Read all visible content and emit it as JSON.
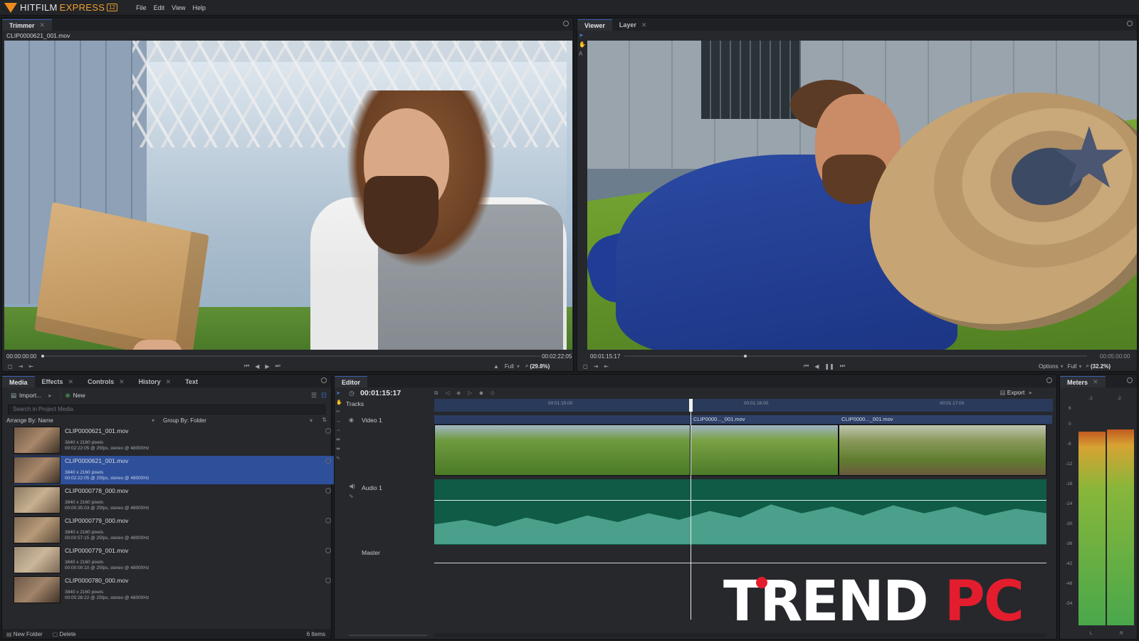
{
  "app": {
    "brand_main": "HITFILM",
    "brand_sub": "EXPRESS",
    "version": "12",
    "menu": [
      "File",
      "Edit",
      "View",
      "Help"
    ]
  },
  "trimmer": {
    "tab": "Trimmer",
    "clip_name": "CLIP0000621_001.mov",
    "time_start": "00:00:00:00",
    "time_end": "00:02:22:05",
    "quality": "Full",
    "zoom": "(29.8%)"
  },
  "viewer": {
    "tabs": [
      "Viewer",
      "Layer"
    ],
    "time_current": "00:01:15:17",
    "time_end": "00:05:00:00",
    "options": "Options",
    "quality": "Full",
    "zoom": "(32.2%)"
  },
  "media_panel": {
    "tabs": [
      "Media",
      "Effects",
      "Controls",
      "History",
      "Text"
    ],
    "import_label": "Import...",
    "new_label": "New",
    "search_placeholder": "Search in Project Media",
    "arrange_by": "Arrange By: Name",
    "group_by": "Group By: Folder",
    "items": [
      {
        "name": "CLIP0000621_001.mov",
        "size": "3840 x 2160 pixels",
        "details": "00:02:22:05 @ 25fps, stereo @ 48000Hz"
      },
      {
        "name": "CLIP0000621_001.mov",
        "size": "3840 x 2160 pixels",
        "details": "00:02:22:05 @ 25fps, stereo @ 48000Hz"
      },
      {
        "name": "CLIP0000778_000.mov",
        "size": "3840 x 2160 pixels",
        "details": "00:00:35:03 @ 25fps, stereo @ 48000Hz"
      },
      {
        "name": "CLIP0000779_000.mov",
        "size": "3840 x 2160 pixels",
        "details": "00:00:57:15 @ 25fps, stereo @ 48000Hz"
      },
      {
        "name": "CLIP0000779_001.mov",
        "size": "3840 x 2160 pixels",
        "details": "00:00:00:10 @ 25fps, stereo @ 48000Hz"
      },
      {
        "name": "CLIP0000780_000.mov",
        "size": "3840 x 2160 pixels",
        "details": "00:00:28:22 @ 25fps, stereo @ 48000Hz"
      }
    ],
    "new_folder": "New Folder",
    "delete": "Delete",
    "item_count": "6 Items"
  },
  "editor": {
    "tab": "Editor",
    "timecode": "00:01:15:17",
    "export_label": "Export",
    "tracks_label": "Tracks",
    "ruler_ticks": [
      "00:01:15:00",
      "00:01:16:00",
      "00:01:17:00"
    ],
    "video_track": "Video 1",
    "audio_track": "Audio 1",
    "master_track": "Master",
    "clip_labels": [
      "CLIP0000..._001.mov",
      "CLIP0000..._001.mov"
    ]
  },
  "meters": {
    "tab": "Meters",
    "scale": [
      "-2",
      "-2",
      "6",
      "0",
      "-6",
      "-12",
      "-18",
      "-24",
      "-30",
      "-36",
      "-42",
      "-48",
      "-54"
    ],
    "channels": [
      "L",
      "R"
    ],
    "level_left": 0.9,
    "level_right": 0.91
  },
  "watermark": {
    "part1": "TREND",
    "part2": "PC"
  },
  "colors": {
    "accent_blue": "#2e4f9a",
    "brand_orange": "#f08a1e",
    "audio_green": "#0f5b45",
    "watermark_red": "#e31d2e"
  }
}
